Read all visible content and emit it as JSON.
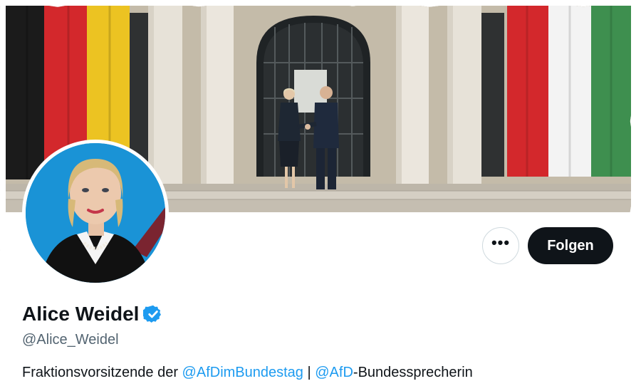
{
  "profile": {
    "display_name": "Alice Weidel",
    "handle": "@Alice_Weidel",
    "verified": true,
    "bio": {
      "part1": "Fraktionsvorsitzende der ",
      "mention1": "@AfDimBundestag",
      "part2": " | ",
      "mention2": "@AfD",
      "part3": "-Bundessprеcherin"
    }
  },
  "actions": {
    "more_icon": "more-horizontal-icon",
    "more_label": "•••",
    "follow_label": "Folgen"
  },
  "colors": {
    "accent": "#1d9bf0",
    "follow_bg": "#0f1419",
    "text_primary": "#0f1419",
    "text_secondary": "#536471",
    "verified": "#1d9bf0"
  },
  "banner": {
    "description_icons": [
      "german-flag",
      "hungarian-flag"
    ]
  }
}
